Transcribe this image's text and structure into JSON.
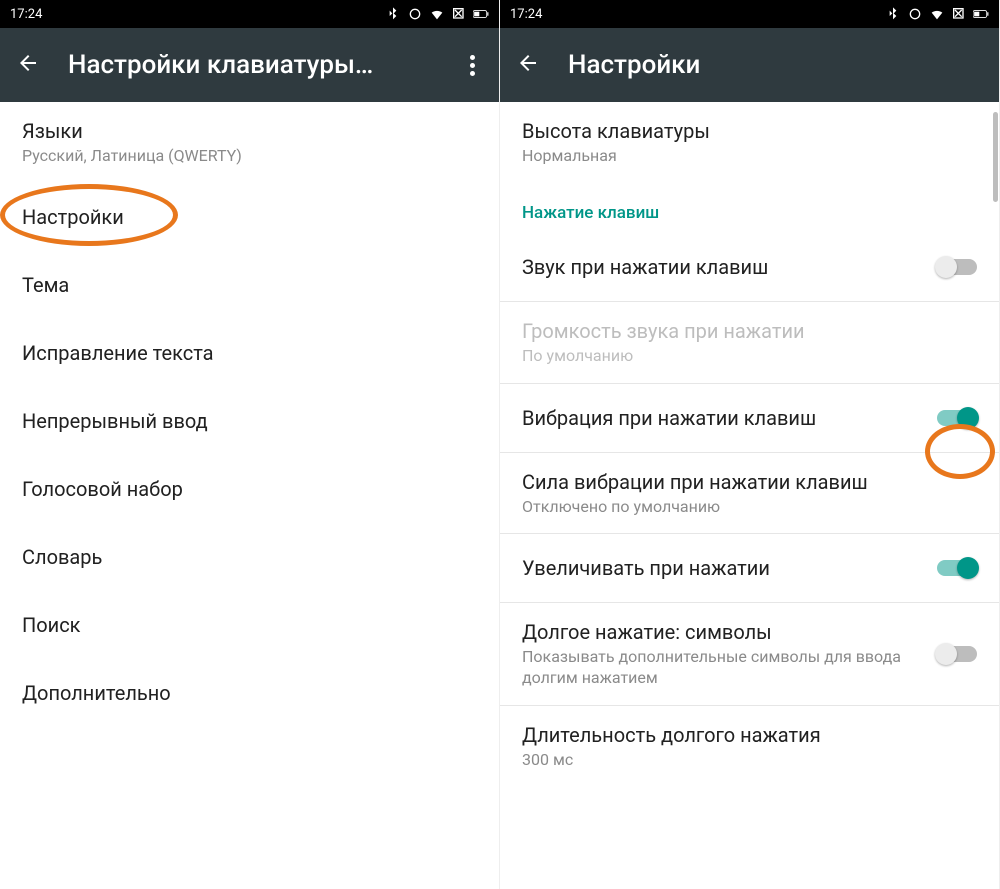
{
  "left": {
    "status_time": "17:24",
    "appbar_title": "Настройки клавиатуры…",
    "items": [
      {
        "title": "Языки",
        "sub": "Русский, Латиница (QWERTY)"
      },
      {
        "title": "Настройки"
      },
      {
        "title": "Тема"
      },
      {
        "title": "Исправление текста"
      },
      {
        "title": "Непрерывный ввод"
      },
      {
        "title": "Голосовой набор"
      },
      {
        "title": "Словарь"
      },
      {
        "title": "Поиск"
      },
      {
        "title": "Дополнительно"
      }
    ]
  },
  "right": {
    "status_time": "17:24",
    "appbar_title": "Настройки",
    "top_item": {
      "title": "Высота клавиатуры",
      "sub": "Нормальная"
    },
    "section": "Нажатие клавиш",
    "rows": [
      {
        "title": "Звук при нажатии клавиш",
        "type": "switch",
        "on": false
      },
      {
        "title": "Громкость звука при нажатии",
        "sub": "По умолчанию",
        "type": "item",
        "disabled": true
      },
      {
        "title": "Вибрация при нажатии клавиш",
        "type": "switch",
        "on": true
      },
      {
        "title": "Сила вибрации при нажатии клавиш",
        "sub": "Отключено по умолчанию",
        "type": "item"
      },
      {
        "title": "Увеличивать при нажатии",
        "type": "switch",
        "on": true
      },
      {
        "title": "Долгое нажатие: символы",
        "sub": "Показывать дополнительные символы для ввода долгим нажатием",
        "type": "switch",
        "on": false
      },
      {
        "title": "Длительность долгого нажатия",
        "sub": "300 мс",
        "type": "item"
      }
    ]
  }
}
